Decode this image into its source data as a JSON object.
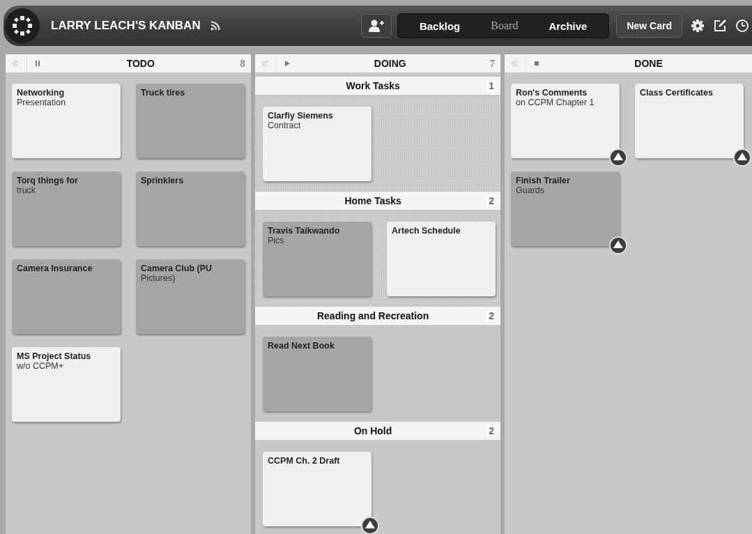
{
  "header": {
    "title": "LARRY LEACH'S KANBAN",
    "nav": [
      {
        "label": "Backlog",
        "selected": false
      },
      {
        "label": "Board",
        "selected": true
      },
      {
        "label": "Archive",
        "selected": false
      }
    ],
    "new_card": "New Card"
  },
  "columns": [
    {
      "title": "TODO",
      "kind": "paused",
      "count": "8",
      "cards": [
        {
          "title": "Networking",
          "text": "Presentation",
          "color": "#f0f0f0",
          "promote": false
        },
        {
          "title": "Truck tires",
          "color": "#a5a5a5",
          "promote": false
        },
        {
          "title": "Torq things for",
          "text": "truck",
          "color": "#a5a5a5",
          "promote": false
        },
        {
          "title": "Sprinklers",
          "color": "#a5a5a5",
          "promote": false
        },
        {
          "title": "Camera Insurance",
          "color": "#a5a5a5",
          "promote": false
        },
        {
          "title": "Camera Club (PU",
          "text": "Pictures)",
          "color": "#a5a5a5",
          "promote": false
        },
        {
          "title": "MS Project Status",
          "text": "w/o CCPM+",
          "color": "#f0f0f0",
          "promote": false
        }
      ]
    },
    {
      "title": "DOING",
      "kind": "playing",
      "count": "7",
      "lanes": [
        {
          "title": "Work Tasks",
          "count": "1",
          "dotted": true,
          "cards": [
            {
              "title": "Clarfiy Siemens",
              "text": "Contract",
              "color": "#f0f0f0",
              "promote": false
            }
          ]
        },
        {
          "title": "Home Tasks",
          "count": "2",
          "dotted": true,
          "cards": [
            {
              "title": "Travis Taikwando",
              "text": "Pics",
              "color": "#a5a5a5",
              "promote": false
            },
            {
              "title": "Artech Schedule",
              "color": "#f0f0f0",
              "promote": false
            }
          ]
        },
        {
          "title": "Reading and Recreation",
          "count": "2",
          "dotted": false,
          "cards": [
            {
              "title": "Read Next Book",
              "color": "#a5a5a5",
              "promote": false
            }
          ]
        },
        {
          "title": "On Hold",
          "count": "2",
          "dotted": false,
          "cards": [
            {
              "title": "CCPM Ch. 2 Draft",
              "color": "#f0f0f0",
              "promote": true
            }
          ]
        }
      ]
    },
    {
      "title": "DONE",
      "kind": "stopped",
      "cards": [
        {
          "title": "Ron's Comments",
          "text": "on CCPM Chapter 1",
          "color": "#f0f0f0",
          "promote": true
        },
        {
          "title": "Class Certificates",
          "color": "#f0f0f0",
          "promote": true
        },
        {
          "title": "Finish Trailer",
          "text": "Guards",
          "color": "#a5a5a5",
          "promote": true
        }
      ]
    }
  ]
}
